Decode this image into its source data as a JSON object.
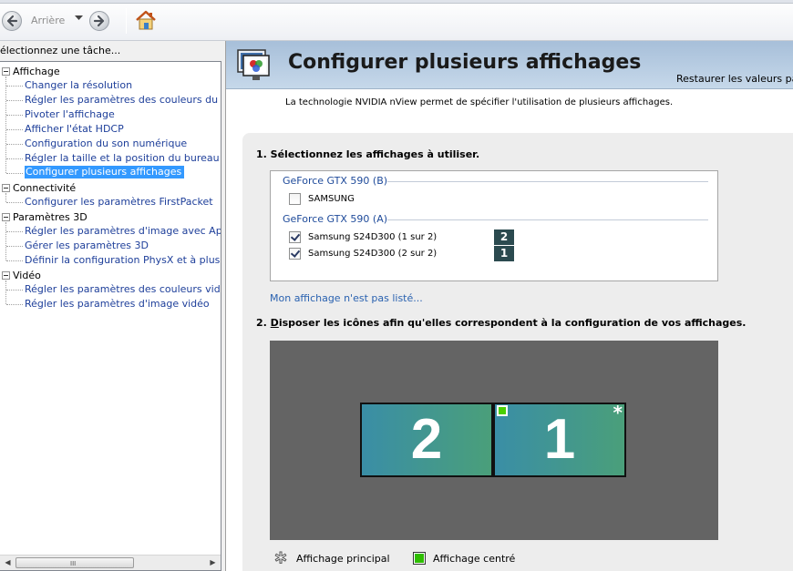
{
  "toolbar": {
    "back_label": "Arrière"
  },
  "sidebar": {
    "task_label": "électionnez une tâche...",
    "categories": [
      {
        "label": "Affichage",
        "items": [
          "Changer la résolution",
          "Régler les paramètres des couleurs du burea",
          "Pivoter l'affichage",
          "Afficher l'état HDCP",
          "Configuration du son numérique",
          "Régler la taille et la position du bureau",
          "Configurer plusieurs affichages"
        ]
      },
      {
        "label": "Connectivité",
        "items": [
          "Configurer les paramètres FirstPacket"
        ]
      },
      {
        "label": "Paramètres 3D",
        "items": [
          "Régler les paramètres d'image avec Aperçu",
          "Gérer les paramètres 3D",
          "Définir la configuration PhysX et à plusieurs p"
        ]
      },
      {
        "label": "Vidéo",
        "items": [
          "Régler les paramètres des couleurs vidéo",
          "Régler les paramètres d'image vidéo"
        ]
      }
    ],
    "selected_item": "Configurer plusieurs affichages",
    "scroll_grip": "III"
  },
  "main": {
    "title": "Configurer plusieurs affichages",
    "restore_link": "Restaurer les valeurs pa",
    "intro": "La technologie NVIDIA nView permet de spécifier l'utilisation de plusieurs affichages.",
    "step1": "1. Sélectionnez les affichages à utiliser.",
    "gpus": [
      {
        "name": "GeForce GTX 590 (B)",
        "displays": [
          {
            "label": "SAMSUNG",
            "checked": false,
            "badge": ""
          }
        ]
      },
      {
        "name": "GeForce GTX 590 (A)",
        "displays": [
          {
            "label": "Samsung S24D300 (1 sur 2)",
            "checked": true,
            "badge": "2"
          },
          {
            "label": "Samsung S24D300 (2 sur 2)",
            "checked": true,
            "badge": "1"
          }
        ]
      }
    ],
    "not_listed": "Mon affichage n'est pas listé...",
    "step2_prefix": "2. ",
    "step2_underlined": "D",
    "step2_rest": "isposer les icônes afin qu'elles correspondent à la configuration de vos affichages.",
    "monitors": [
      {
        "number": "2",
        "center": false,
        "primary": false
      },
      {
        "number": "1",
        "center": true,
        "primary": true
      }
    ],
    "primary_star": "*",
    "legend_primary": "Affichage principal",
    "legend_center": "Affichage centré"
  },
  "colors": {
    "header_bg": "#b4c9e0",
    "selection": "#3399ff",
    "link": "#2a62b0",
    "arrange_bg": "#646464",
    "badge_bg": "#2b4a4f",
    "center_green": "#4ad000"
  }
}
